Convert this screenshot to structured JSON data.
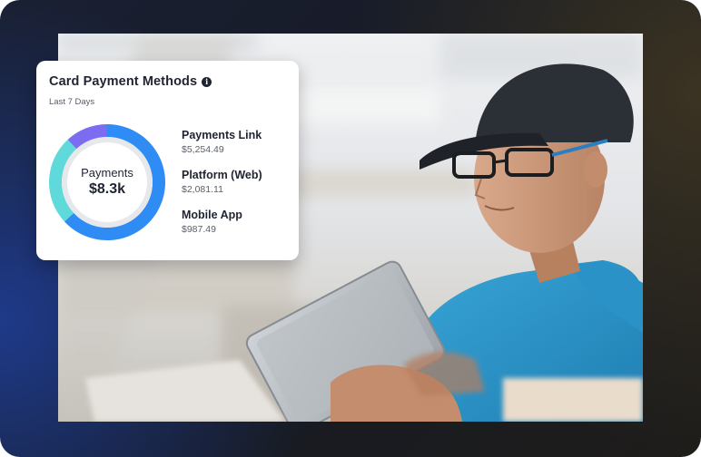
{
  "card": {
    "title": "Card Payment Methods",
    "subtitle": "Last 7 Days",
    "info_icon": "info-icon",
    "center_label": "Payments",
    "center_value": "$8.3k",
    "methods": [
      {
        "name": "Payments Link",
        "amount": "$5,254.49",
        "value": 5254.49,
        "color": "#2f8cf4"
      },
      {
        "name": "Platform (Web)",
        "amount": "$2,081.11",
        "value": 2081.11,
        "color": "#5fd9d9"
      },
      {
        "name": "Mobile App",
        "amount": "$987.49",
        "value": 987.49,
        "color": "#7c6cf2"
      }
    ]
  },
  "colors": {
    "primary_blue": "#2f8cf4",
    "teal": "#5fd9d9",
    "violet": "#7c6cf2",
    "ring_inner": "#e6e8ec"
  }
}
